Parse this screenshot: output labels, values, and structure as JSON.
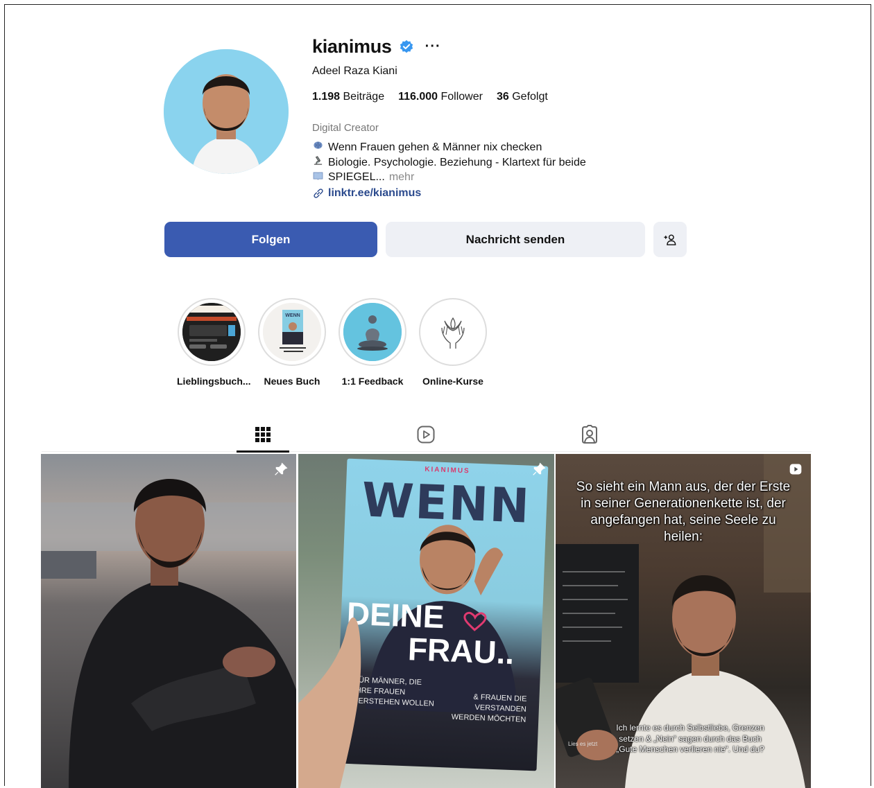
{
  "profile": {
    "username": "kianimus",
    "more_label": "···",
    "full_name": "Adeel Raza Kiani",
    "stats": {
      "posts_count": "1.198",
      "posts_label": "Beiträge",
      "followers_count": "116.000",
      "followers_label": "Follower",
      "following_count": "36",
      "following_label": "Gefolgt"
    },
    "category": "Digital Creator",
    "bio_lines": [
      "Wenn Frauen gehen & Männer nix checken",
      "Biologie. Psychologie. Beziehung - Klartext für beide",
      "SPIEGEL..."
    ],
    "bio_more": "mehr",
    "link": "linktr.ee/kianimus"
  },
  "buttons": {
    "follow": "Folgen",
    "message": "Nachricht senden"
  },
  "highlights": [
    {
      "label": "Lieblingsbuch..."
    },
    {
      "label": "Neues Buch"
    },
    {
      "label": "1:1 Feedback"
    },
    {
      "label": "Online-Kurse"
    }
  ],
  "tabs": [
    "posts-tab",
    "reels-tab",
    "tagged-tab"
  ],
  "posts": {
    "book": {
      "brand": "KIANIMUS",
      "title_top": "WENN",
      "title_mid": "DEINE",
      "title_bottom": "FRAU..",
      "left_text": "FÜR MÄNNER, DIE IHRE FRAUEN VERSTEHEN WOLLEN",
      "right_text": "& FRAUEN DIE VERSTANDEN WERDEN MÖCHTEN"
    },
    "reel": {
      "headline": "So sieht ein Mann aus, der der Erste in seiner Generationenkette ist, der angefangen hat, seine Seele zu heilen:",
      "caption": "Ich lernte es durch Selbstliebe, Grenzen setzen & „Nein“ sagen durch das Buch „Gute Menschen verlieren nie“. Und du?",
      "side_note": "Lies es jetzt"
    }
  },
  "colors": {
    "follow_button": "#3a5bb1",
    "link": "#2b4a8d",
    "verified": "#3897f0",
    "secondary_button": "#eef0f5"
  }
}
